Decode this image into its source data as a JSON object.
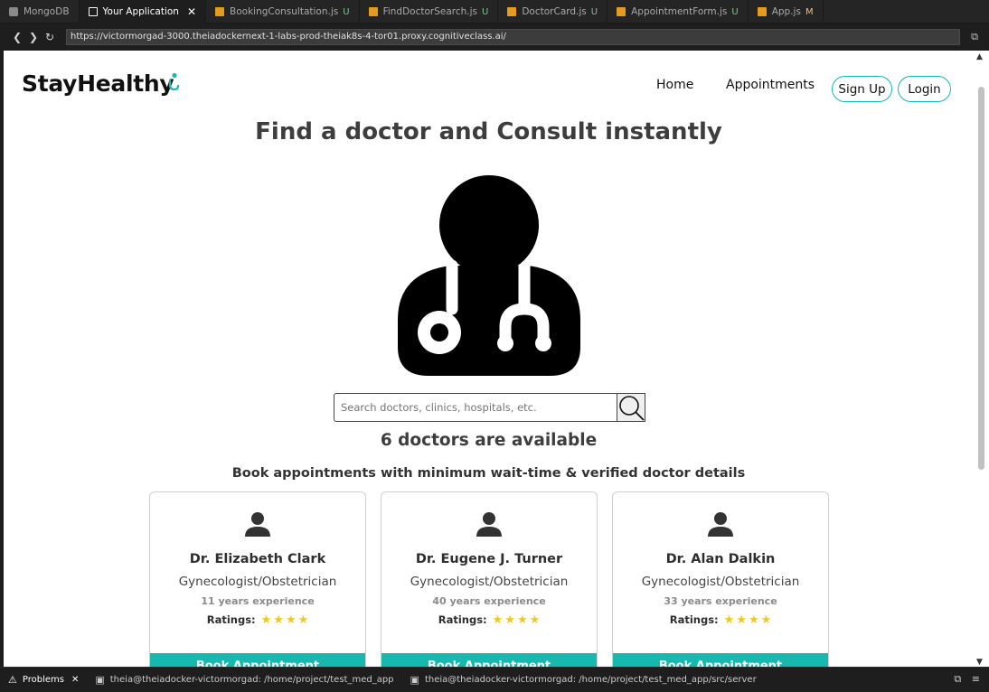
{
  "ide_tabs": [
    {
      "label": "MongoDB",
      "icon": "database-icon",
      "status": ""
    },
    {
      "label": "Your Application",
      "icon": "web-preview-icon",
      "status": ""
    },
    {
      "label": "BookingConsultation.js",
      "icon": "js-file-icon",
      "status": "U"
    },
    {
      "label": "FindDoctorSearch.js",
      "icon": "js-file-icon",
      "status": "U"
    },
    {
      "label": "DoctorCard.js",
      "icon": "js-file-icon",
      "status": "U"
    },
    {
      "label": "AppointmentForm.js",
      "icon": "js-file-icon",
      "status": "U"
    },
    {
      "label": "App.js",
      "icon": "js-file-icon",
      "status": "M"
    }
  ],
  "browser": {
    "url": "https://victormorgad-3000.theiadockernext-1-labs-prod-theiak8s-4-tor01.proxy.cognitiveclass.ai/"
  },
  "site": {
    "logo": "StayHealthy",
    "nav": {
      "home": "Home",
      "appointments": "Appointments"
    },
    "signup_label": "Sign Up",
    "login_label": "Login",
    "hero_title": "Find a doctor and Consult instantly",
    "search_placeholder": "Search doctors, clinics, hospitals, etc.",
    "available_text": "6 doctors are available",
    "subheading": "Book appointments with minimum wait-time & verified doctor details",
    "ratings_label": "Ratings:",
    "book_label": "Book Appointment",
    "accent_color": "#17b8b0",
    "star_color": "#f5c518"
  },
  "doctors": [
    {
      "name": "Dr. Elizabeth Clark",
      "speciality": "Gynecologist/Obstetrician",
      "experience": "11 years experience",
      "rating": 4
    },
    {
      "name": "Dr. Eugene J. Turner",
      "speciality": "Gynecologist/Obstetrician",
      "experience": "40 years experience",
      "rating": 4
    },
    {
      "name": "Dr. Alan Dalkin",
      "speciality": "Gynecologist/Obstetrician",
      "experience": "33 years experience",
      "rating": 4
    }
  ],
  "bottom_panel": {
    "problems_label": "Problems",
    "terminal1": "theia@theiadocker-victormorgad: /home/project/test_med_app",
    "terminal2": "theia@theiadocker-victormorgad: /home/project/test_med_app/src/server"
  }
}
